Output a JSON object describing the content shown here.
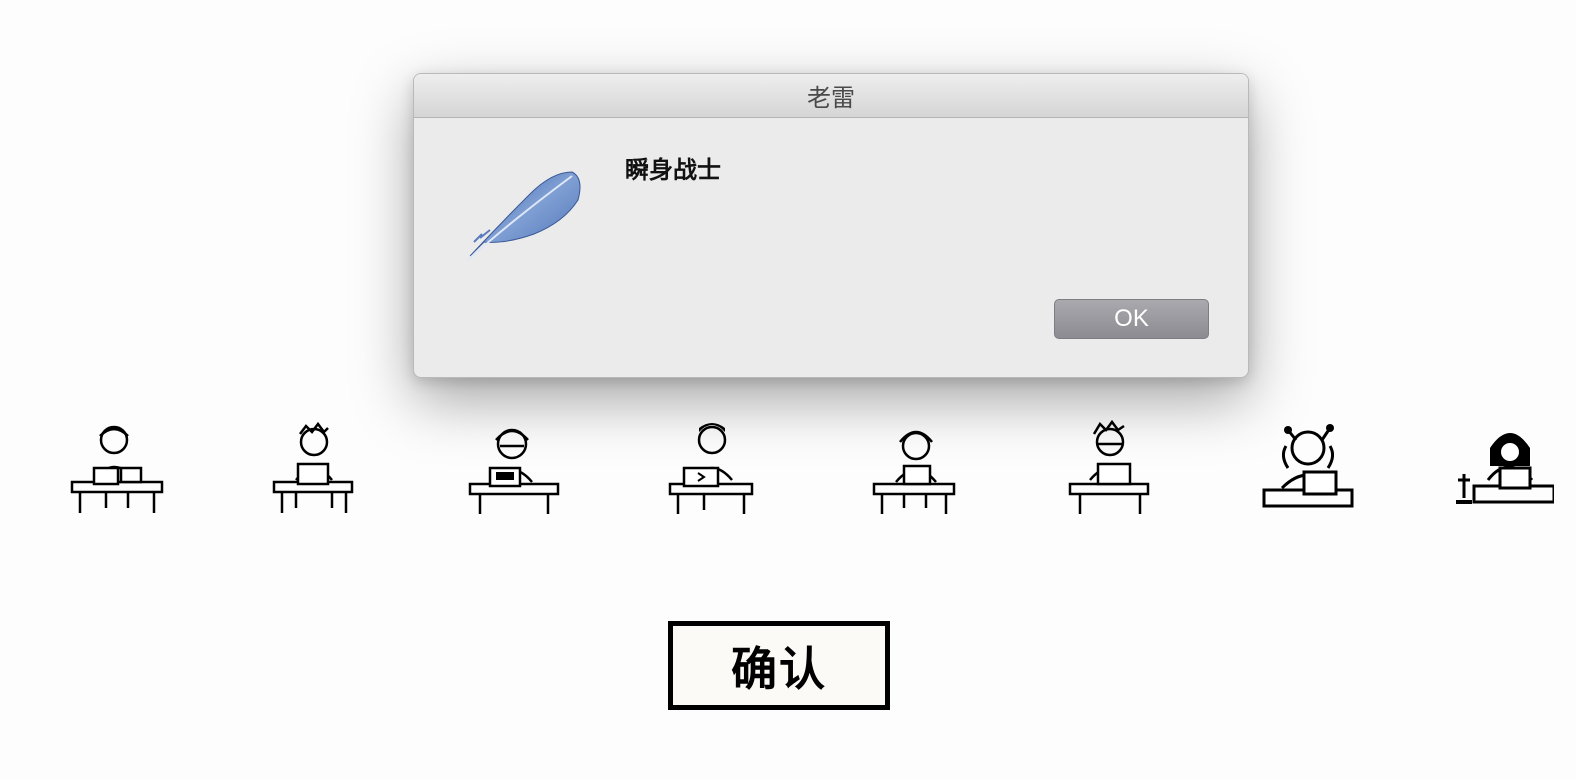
{
  "dialog": {
    "title": "老雷",
    "message": "瞬身战士",
    "icon": "feather-icon",
    "ok_label": "OK"
  },
  "confirm_button": {
    "label": "确认"
  },
  "characters": [
    {
      "name": "pixel-character-1"
    },
    {
      "name": "pixel-character-2"
    },
    {
      "name": "pixel-character-3"
    },
    {
      "name": "pixel-character-4"
    },
    {
      "name": "pixel-character-5"
    },
    {
      "name": "pixel-character-6"
    },
    {
      "name": "pixel-character-7"
    },
    {
      "name": "pixel-character-8"
    }
  ],
  "colors": {
    "feather": "#6f8fc4",
    "ok_button": "#9a9aa0",
    "dialog_bg": "#ebebeb"
  }
}
